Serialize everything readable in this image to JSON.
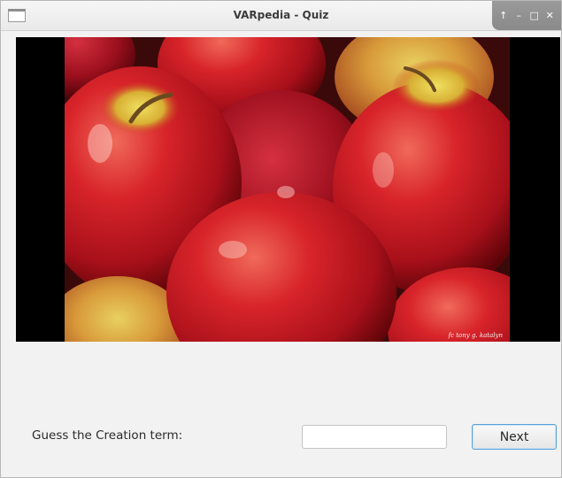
{
  "window": {
    "title": "VARpedia - Quiz",
    "controls": {
      "up": "↑",
      "minimize": "–",
      "maximize": "□",
      "close": "✕"
    }
  },
  "image": {
    "caption": "fc tony g. katalyn"
  },
  "quiz": {
    "prompt_label": "Guess the Creation term:",
    "answer_value": "",
    "answer_placeholder": "",
    "next_label": "Next"
  },
  "colors": {
    "accent_border": "#5aa0d8",
    "window_bg": "#f2f2f2",
    "titlebar_controls": "#8e8e8e"
  }
}
